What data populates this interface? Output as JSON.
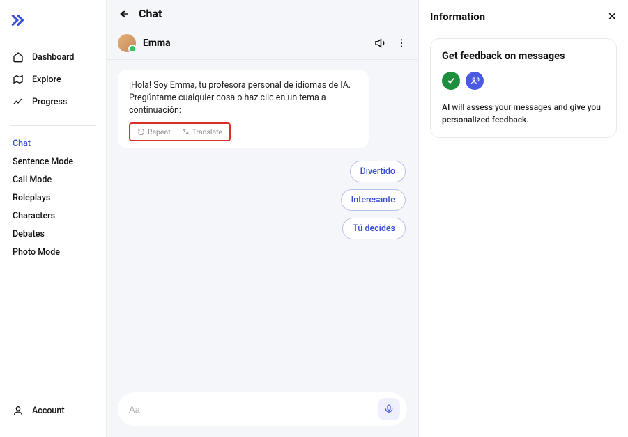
{
  "sidebar": {
    "nav": [
      {
        "label": "Dashboard"
      },
      {
        "label": "Explore"
      },
      {
        "label": "Progress"
      }
    ],
    "subnav": [
      {
        "label": "Chat",
        "active": true
      },
      {
        "label": "Sentence Mode"
      },
      {
        "label": "Call Mode"
      },
      {
        "label": "Roleplays"
      },
      {
        "label": "Characters"
      },
      {
        "label": "Debates"
      },
      {
        "label": "Photo Mode"
      }
    ],
    "account_label": "Account"
  },
  "chat": {
    "title": "Chat",
    "tutor_name": "Emma",
    "message": "¡Hola! Soy Emma, tu profesora personal de idiomas de IA. Pregúntame cualquier cosa o haz clic en un tema a continuación:",
    "repeat_label": "Repeat",
    "translate_label": "Translate",
    "suggestions": [
      "Divertido",
      "Interesante",
      "Tú decides"
    ],
    "input_placeholder": "Aa"
  },
  "info": {
    "panel_title": "Information",
    "card_title": "Get feedback on messages",
    "description": "AI will assess your messages and give you personalized feedback."
  }
}
